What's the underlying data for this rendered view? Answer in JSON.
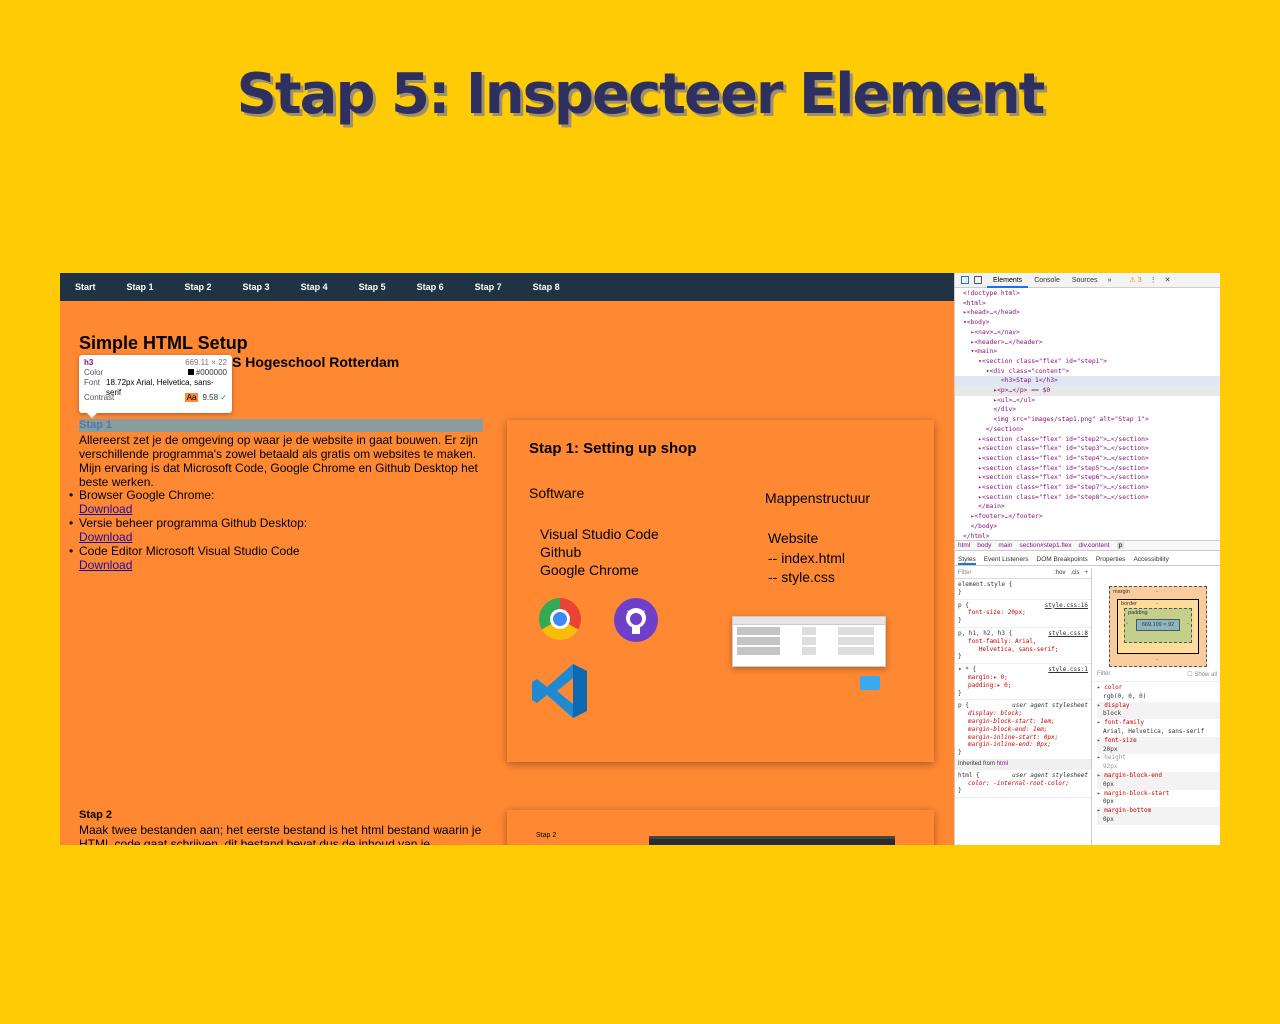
{
  "slide": {
    "title": "Stap 5: Inspecteer Element"
  },
  "nav": {
    "items": [
      "Start",
      "Stap 1",
      "Stap 2",
      "Stap 3",
      "Stap 4",
      "Stap 5",
      "Stap 6",
      "Stap 7",
      "Stap 8"
    ]
  },
  "header": {
    "title": "Simple HTML Setup",
    "subtitle": "S Hogeschool Rotterdam"
  },
  "tooltip": {
    "tag": "h3",
    "dims": "669.11 × 22",
    "color_label": "Color",
    "color_value": "#000000",
    "font_label": "Font",
    "font_value": "18.72px Arial, Helvetica, sans-serif",
    "contrast_label": "Contrast",
    "contrast_badge": "Aa",
    "contrast_value": "9.58"
  },
  "step1": {
    "heading": "Stap 1",
    "text": "Allereerst zet je de omgeving op waar je de website in gaat bouwen. Er zijn verschillende programma's zowel betaald als gratis om websites te maken. Mijn ervaring is dat Microsoft Code, Google Chrome en Github Desktop het beste werken.",
    "items": [
      {
        "label": "Browser Google Chrome:",
        "link": "Download"
      },
      {
        "label": "Versie beheer programma Github Desktop:",
        "link": "Download"
      },
      {
        "label": "Code Editor Microsoft Visual Studio Code",
        "link": "Download"
      }
    ]
  },
  "card1": {
    "title": "Stap 1: Setting up shop",
    "software_label": "Software",
    "tools": [
      "Visual Studio Code",
      "Github",
      "Google Chrome"
    ],
    "folder_label": "Mappenstructuur",
    "folder_items": [
      "Website",
      "-- index.html",
      "-- style.css"
    ]
  },
  "step2": {
    "heading": "Stap 2",
    "text": "Maak twee bestanden aan; het eerste bestand is het html bestand waarin je HTML code gaat schrijven, dit bestand bevat dus de inhoud van je",
    "card_label": "Stap 2"
  },
  "devtools": {
    "tabs": [
      "Elements",
      "Console",
      "Sources"
    ],
    "more": "»",
    "warnings": "⚠ 3",
    "kebab": "⋮",
    "close": "✕",
    "dom_lines": [
      "<!doctype html>",
      "<html>",
      "▸<head>…</head>",
      "▾<body>",
      "  ▸<nav>…</nav>",
      "  ▸<header>…</header>",
      "  ▾<main>",
      "    ▾<section class=\"flex\" id=\"step1\">",
      "      ▾<div class=\"content\">",
      "          <h3>Stap 1</h3>",
      "        ▸<p>…</p> == $0",
      "        ▸<ul>…</ul>",
      "        </div>",
      "        <img src=\"images/stap1.png\" alt=\"Stap 1\">",
      "      </section>",
      "    ▸<section class=\"flex\" id=\"step2\">…</section>",
      "    ▸<section class=\"flex\" id=\"step3\">…</section>",
      "    ▸<section class=\"flex\" id=\"step4\">…</section>",
      "    ▸<section class=\"flex\" id=\"step5\">…</section>",
      "    ▸<section class=\"flex\" id=\"step6\">…</section>",
      "    ▸<section class=\"flex\" id=\"step7\">…</section>",
      "    ▸<section class=\"flex\" id=\"step8\">…</section>",
      "    </main>",
      "  ▸<footer>…</footer>",
      "  </body>",
      "</html>"
    ],
    "crumbs": [
      "html",
      "body",
      "main",
      "section#step1.flex",
      "div.content",
      "p"
    ],
    "subtabs": [
      "Styles",
      "Event Listeners",
      "DOM Breakpoints",
      "Properties",
      "Accessibility"
    ],
    "filter_placeholder": "Filter",
    "filter_hov": ":hov",
    "filter_cls": ".cls",
    "filter_plus": "+",
    "rules": [
      {
        "selector": "element.style {",
        "source": "",
        "props": [],
        "close": "}"
      },
      {
        "selector": "p {",
        "source": "style.css:16",
        "props": [
          "font-size: 20px;"
        ],
        "close": "}"
      },
      {
        "selector": "p, h1, h2, h3 {",
        "source": "style.css:8",
        "props": [
          "font-family: Arial,",
          "   Helvetica, sans-serif;"
        ],
        "close": "}"
      },
      {
        "selector": "▾ * {",
        "source": "style.css:1",
        "props": [
          "margin:▸ 0;",
          "padding:▸ 0;"
        ],
        "close": "}"
      }
    ],
    "ua_rule": {
      "selector": "p {",
      "source": "user agent stylesheet",
      "props": [
        "display: block;",
        "margin-block-start: 1em;",
        "margin-block-end: 1em;",
        "margin-inline-start: 0px;",
        "margin-inline-end: 0px;"
      ],
      "close": "}"
    },
    "inherited_label": "Inherited from",
    "inherited_tag": "html",
    "html_rule": {
      "selector": "html {",
      "source": "user agent stylesheet",
      "props": [
        "color: -internal-root-color;"
      ],
      "close": "}"
    },
    "boxmodel": {
      "margin": "margin",
      "border": "border",
      "padding": "padding",
      "content": "669.109 × 92",
      "dash": "-"
    },
    "computed_filter": "Filter",
    "show_all": "Show all",
    "computed": [
      {
        "k": "color",
        "v": "rgb(0, 0, 0)"
      },
      {
        "k": "display",
        "v": "block"
      },
      {
        "k": "font-family",
        "v": "Arial, Helvetica, sans-serif"
      },
      {
        "k": "font-size",
        "v": "20px"
      },
      {
        "k": "height",
        "v": "92px",
        "dim": true
      },
      {
        "k": "margin-block-end",
        "v": "0px"
      },
      {
        "k": "margin-block-start",
        "v": "0px"
      },
      {
        "k": "margin-bottom",
        "v": "0px"
      }
    ]
  }
}
